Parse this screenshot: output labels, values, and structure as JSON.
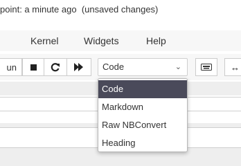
{
  "header": {
    "checkpoint_text": "point: a minute ago",
    "unsaved_text": "(unsaved changes)"
  },
  "menubar": {
    "items": [
      {
        "label": "Kernel"
      },
      {
        "label": "Widgets"
      },
      {
        "label": "Help"
      }
    ]
  },
  "toolbar": {
    "run_label": "un",
    "stop_icon": "stop-icon",
    "restart_icon": "restart-icon",
    "fast_forward_icon": "fast-forward-icon",
    "keyboard_icon": "keyboard-icon",
    "cell_type_select": {
      "value": "Code",
      "options": [
        "Code",
        "Markdown",
        "Raw NBConvert",
        "Heading"
      ],
      "selected_index": 0
    }
  },
  "colors": {
    "selected_bg": "#4a4a5a",
    "toolbar_bg": "#f7f7f7",
    "notebook_bg": "#eeeeee"
  }
}
